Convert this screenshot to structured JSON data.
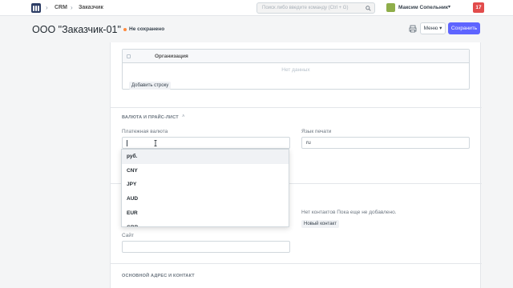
{
  "navbar": {
    "breadcrumbs": [
      "CRM",
      "Заказчик"
    ],
    "search_placeholder": "Поиск либо введите команду (Ctrl + G)",
    "user_name": "Максим Сопельник",
    "notification_count": "17"
  },
  "page": {
    "title": "ООО \"Заказчик-01\"",
    "status": "Не сохранено",
    "menu_label": "Меню",
    "save_label": "Сохранить"
  },
  "grid": {
    "column_header": "Организация",
    "empty_text": "Нет данных",
    "add_row_label": "Добавить строку"
  },
  "currency_section": {
    "title": "ВАЛЮТА И ПРАЙС-ЛИСТ",
    "currency_label": "Платежная валюта",
    "currency_value": "",
    "print_lang_label": "Язык печати",
    "print_lang_value": "ru"
  },
  "dropdown": {
    "options": [
      "руб.",
      "CNY",
      "JPY",
      "AUD",
      "EUR",
      "GBP"
    ]
  },
  "contacts_section": {
    "no_contacts_text": "Нет контактов Пока еще не добавлено.",
    "new_contact_label": "Новый контакт",
    "website_label": "Сайт"
  },
  "address_section": {
    "title": "ОСНОВНОЙ АДРЕС И КОНТАКТ"
  },
  "colors": {
    "primary": "#5e64ff",
    "notification": "#e24c4c",
    "unsaved_dot": "#ff8a3d"
  }
}
